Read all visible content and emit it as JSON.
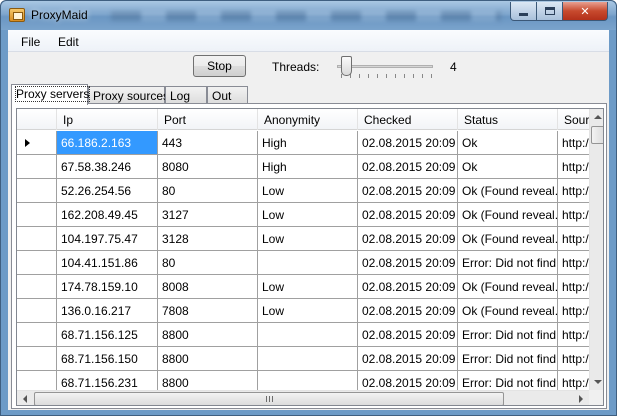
{
  "window": {
    "title": "ProxyMaid",
    "controls": {
      "minimize": "minimize",
      "maximize": "maximize",
      "close": "✕"
    }
  },
  "menu": {
    "items": [
      "File",
      "Edit"
    ]
  },
  "toolbar": {
    "stop_label": "Stop",
    "threads_label": "Threads:",
    "threads_value": "4"
  },
  "tabs": [
    {
      "label": "Proxy servers",
      "active": true
    },
    {
      "label": "Proxy sources",
      "active": false
    },
    {
      "label": "Log",
      "active": false
    },
    {
      "label": "Out",
      "active": false
    }
  ],
  "grid": {
    "columns": [
      "Ip",
      "Port",
      "Anonymity",
      "Checked",
      "Status",
      "Sour"
    ],
    "rows": [
      {
        "ip": "66.186.2.163",
        "port": "443",
        "anonymity": "High",
        "checked": "02.08.2015 20:09",
        "status": "Ok",
        "source": "http:/"
      },
      {
        "ip": "67.58.38.246",
        "port": "8080",
        "anonymity": "High",
        "checked": "02.08.2015 20:09",
        "status": "Ok",
        "source": "http:/"
      },
      {
        "ip": "52.26.254.56",
        "port": "80",
        "anonymity": "Low",
        "checked": "02.08.2015 20:09",
        "status": "Ok (Found reveal...",
        "source": "http:/"
      },
      {
        "ip": "162.208.49.45",
        "port": "3127",
        "anonymity": "Low",
        "checked": "02.08.2015 20:09",
        "status": "Ok (Found reveal...",
        "source": "http:/"
      },
      {
        "ip": "104.197.75.47",
        "port": "3128",
        "anonymity": "Low",
        "checked": "02.08.2015 20:09",
        "status": "Ok (Found reveal...",
        "source": "http:/"
      },
      {
        "ip": "104.41.151.86",
        "port": "80",
        "anonymity": "",
        "checked": "02.08.2015 20:09",
        "status": "Error: Did not find...",
        "source": "http:/"
      },
      {
        "ip": "174.78.159.10",
        "port": "8008",
        "anonymity": "Low",
        "checked": "02.08.2015 20:09",
        "status": "Ok (Found reveal...",
        "source": "http:/"
      },
      {
        "ip": "136.0.16.217",
        "port": "7808",
        "anonymity": "Low",
        "checked": "02.08.2015 20:09",
        "status": "Ok (Found reveal...",
        "source": "http:/"
      },
      {
        "ip": "68.71.156.125",
        "port": "8800",
        "anonymity": "",
        "checked": "02.08.2015 20:09",
        "status": "Error: Did not find...",
        "source": "http:/"
      },
      {
        "ip": "68.71.156.150",
        "port": "8800",
        "anonymity": "",
        "checked": "02.08.2015 20:09",
        "status": "Error: Did not find...",
        "source": "http:/"
      },
      {
        "ip": "68.71.156.231",
        "port": "8800",
        "anonymity": "",
        "checked": "02.08.2015 20:09",
        "status": "Error: Did not find...",
        "source": "http:/"
      }
    ],
    "selected_row": 0,
    "hscroll_grip": "|||"
  }
}
